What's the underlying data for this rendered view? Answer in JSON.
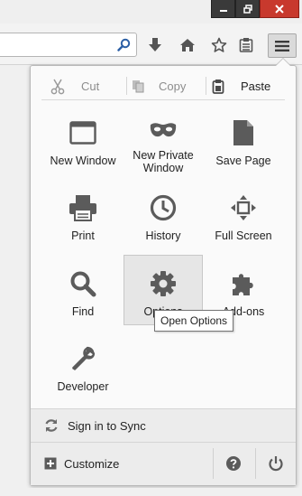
{
  "window_controls": [
    {
      "name": "minimize-icon"
    },
    {
      "name": "restore-icon"
    },
    {
      "name": "close-icon"
    }
  ],
  "toolbar": {
    "url_value": "",
    "icons": [
      "search-icon",
      "download-icon",
      "home-icon",
      "bookmark-star-icon",
      "reading-list-icon",
      "hamburger-menu-icon"
    ]
  },
  "menu": {
    "edit": {
      "cut": "Cut",
      "copy": "Copy",
      "paste": "Paste"
    },
    "items": [
      {
        "label": "New Window",
        "icon": "new-window-icon"
      },
      {
        "label": "New Private Window",
        "icon": "private-mask-icon"
      },
      {
        "label": "Save Page",
        "icon": "save-page-icon"
      },
      {
        "label": "Print",
        "icon": "printer-icon"
      },
      {
        "label": "History",
        "icon": "clock-icon"
      },
      {
        "label": "Full Screen",
        "icon": "fullscreen-icon"
      },
      {
        "label": "Find",
        "icon": "magnifier-icon"
      },
      {
        "label": "Options",
        "icon": "gear-icon"
      },
      {
        "label": "Add-ons",
        "icon": "puzzle-icon"
      },
      {
        "label": "Developer",
        "icon": "wrench-icon"
      }
    ],
    "tooltip": "Open Options",
    "sync": "Sign in to Sync",
    "customize": "Customize"
  },
  "colors": {
    "close_button": "#c8392d",
    "icon_gray": "#5b5b5b",
    "panel_bg": "#fafafa",
    "footer_bg": "#ececec"
  }
}
